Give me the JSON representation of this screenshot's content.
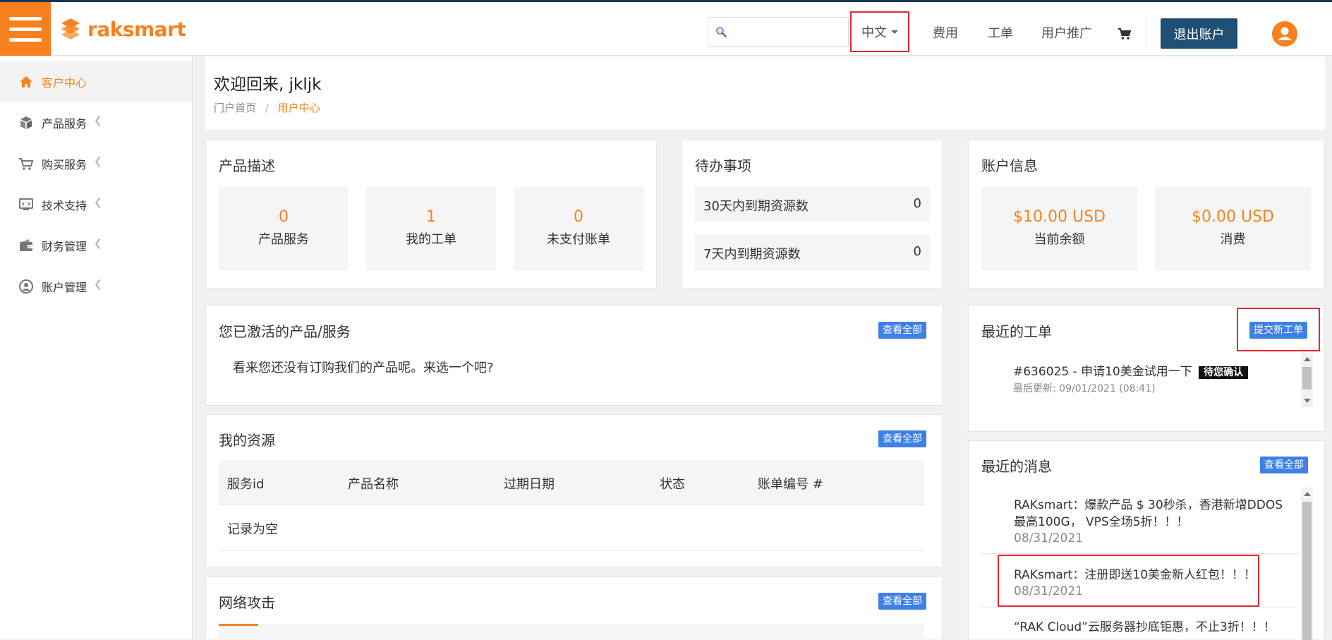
{
  "brand": {
    "name": "raksmart"
  },
  "header": {
    "search_placeholder": "",
    "language": "中文",
    "links": [
      "费用",
      "工单",
      "用户推广"
    ],
    "logout": "退出账户"
  },
  "sidebar": {
    "items": [
      {
        "label": "客户中心",
        "icon": "home-icon",
        "active": true
      },
      {
        "label": "产品服务",
        "icon": "box-icon"
      },
      {
        "label": "购买服务",
        "icon": "cart-icon"
      },
      {
        "label": "技术支持",
        "icon": "support-icon"
      },
      {
        "label": "财务管理",
        "icon": "wallet-icon"
      },
      {
        "label": "账户管理",
        "icon": "user-circle-icon"
      }
    ]
  },
  "welcome": {
    "title": "欢迎回来, jkljk",
    "breadcrumb": {
      "home": "门户首页",
      "sep": "/",
      "current": "用户中心"
    }
  },
  "product_desc": {
    "title": "产品描述",
    "stats": [
      {
        "value": "0",
        "label": "产品服务"
      },
      {
        "value": "1",
        "label": "我的工单"
      },
      {
        "value": "0",
        "label": "未支付账单"
      }
    ]
  },
  "todo": {
    "title": "待办事项",
    "rows": [
      {
        "label": "30天内到期资源数",
        "value": "0"
      },
      {
        "label": "7天内到期资源数",
        "value": "0"
      }
    ]
  },
  "account": {
    "title": "账户信息",
    "stats": [
      {
        "value": "$10.00 USD",
        "label": "当前余额"
      },
      {
        "value": "$0.00 USD",
        "label": "消费"
      }
    ]
  },
  "active_products": {
    "title": "您已激活的产品/服务",
    "view_all": "查看全部",
    "empty": "看来您还没有订购我们的产品呢。来选一个吧?"
  },
  "resources": {
    "title": "我的资源",
    "view_all": "查看全部",
    "columns": [
      "服务id",
      "产品名称",
      "过期日期",
      "状态",
      "账单编号 #"
    ],
    "empty": "记录为空"
  },
  "attacks": {
    "title": "网络攻击",
    "view_all": "查看全部"
  },
  "tickets": {
    "title": "最近的工单",
    "new_button": "提交新工单",
    "items": [
      {
        "title": "#636025 - 申请10美金试用一下",
        "badge": "待您确认",
        "updated": "最后更新: 09/01/2021 (08:41)"
      }
    ]
  },
  "news": {
    "title": "最近的消息",
    "view_all": "查看全部",
    "items": [
      {
        "line1": "RAKsmart：爆款产品 $ 30秒杀，香港新增DDOS",
        "line2": "最高100G， VPS全场5折！！！",
        "date": "08/31/2021"
      },
      {
        "line1": "RAKsmart：注册即送10美金新人红包！！！",
        "date": "08/31/2021"
      },
      {
        "line1": "“RAK Cloud”云服务器抄底钜惠，不止3折！！！"
      }
    ]
  },
  "colors": {
    "brand": "#f7811f",
    "header_line": "#1d3550",
    "logout_bg": "#1f4f74",
    "button_blue": "#3f7fe8",
    "highlight_red": "#e8262f"
  }
}
